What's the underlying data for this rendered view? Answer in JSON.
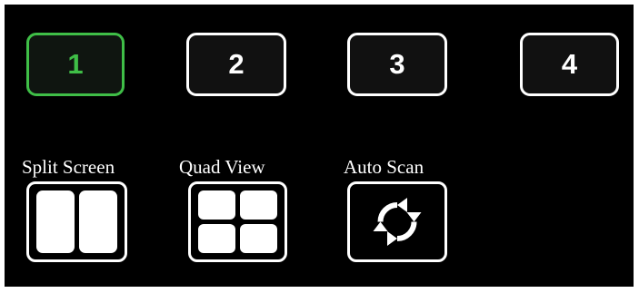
{
  "camera_buttons": [
    {
      "label": "1",
      "state": "selected"
    },
    {
      "label": "2",
      "state": "normal"
    },
    {
      "label": "3",
      "state": "normal"
    },
    {
      "label": "4",
      "state": "normal"
    }
  ],
  "view_modes": {
    "split_screen": {
      "label": "Split Screen",
      "icon": "split-screen-icon"
    },
    "quad_view": {
      "label": "Quad View",
      "icon": "quad-view-icon"
    },
    "auto_scan": {
      "label": "Auto Scan",
      "icon": "rotate-arrows-icon"
    }
  },
  "colors": {
    "background": "#000000",
    "button_border": "#ffffff",
    "selected_accent": "#3fbe47"
  }
}
